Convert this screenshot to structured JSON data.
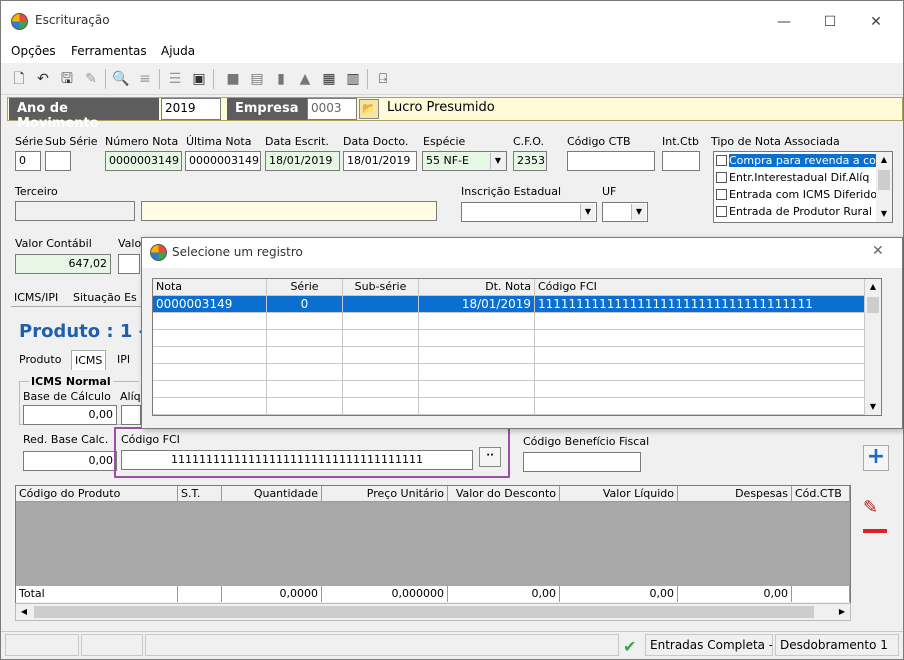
{
  "window": {
    "title": "Escrituração",
    "min": "—",
    "max": "☐",
    "close": "✕"
  },
  "menu": [
    "Opções",
    "Ferramentas",
    "Ajuda"
  ],
  "header": {
    "ano_label": "Ano de Movimento",
    "ano_value": "2019",
    "empresa_label": "Empresa",
    "empresa_code": "0003",
    "empresa_name": "Lucro Presumido"
  },
  "form": {
    "serie_label": "Série",
    "serie_value": "0",
    "subserie_label": "Sub Série",
    "subserie_value": "",
    "numero_label": "Número Nota",
    "numero_value": "0000003149",
    "ultima_label": "Última Nota",
    "ultima_value": "0000003149",
    "dataescrit_label": "Data Escrit.",
    "dataescrit_value": "18/01/2019",
    "datadocto_label": "Data Docto.",
    "datadocto_value": "18/01/2019",
    "especie_label": "Espécie",
    "especie_value": "55   NF-E",
    "cfo_label": "C.F.O.",
    "cfo_value": "2353",
    "ctb_label": "Código CTB",
    "ctb_value": "",
    "intctb_label": "Int.Ctb",
    "intctb_value": "",
    "tiponota_label": "Tipo de Nota Associada",
    "tiponota_items": [
      "Compra para revenda a co",
      "Entr.Interestadual Dif.Alíq",
      "Entrada com ICMS Diferido",
      "Entrada de Produtor Rural"
    ],
    "terceiro_label": "Terceiro",
    "ie_label": "Inscrição Estadual",
    "uf_label": "UF",
    "valorcontabil_label": "Valor Contábil",
    "valorcontabil_value": "647,02",
    "valo_label": "Valo"
  },
  "tabs": [
    "ICMS/IPI",
    "Situação Es"
  ],
  "produto_title": "Produto : 1 -",
  "subtabs": [
    "Produto",
    "ICMS",
    "IPI"
  ],
  "icms": {
    "group_label": "ICMS Normal",
    "base_label": "Base de Cálculo",
    "base_value": "0,00",
    "aliq_label": "Alíq",
    "red_label": "Red. Base Calc.",
    "red_value": "0,00",
    "fci_label": "Código FCI",
    "fci_value": "111111111111111111111111111111111111",
    "beneficio_label": "Código Benefício Fiscal",
    "beneficio_value": "",
    "fci_button": "··"
  },
  "dialog": {
    "title": "Selecione um registro",
    "columns": [
      "Nota",
      "Série",
      "Sub-série",
      "Dt. Nota",
      "Código FCI"
    ],
    "rows": [
      [
        "0000003149",
        "0",
        "",
        "18/01/2019",
        "111111111111111111111111111111111111"
      ]
    ]
  },
  "product_table": {
    "columns": [
      "Código do Produto",
      "S.T.",
      "Quantidade",
      "Preço Unitário",
      "Valor do Desconto",
      "Valor Líquido",
      "Despesas",
      "Cód.CTB"
    ],
    "totals": [
      "Total",
      "",
      "0,0000",
      "0,000000",
      "0,00",
      "0,00",
      "0,00",
      ""
    ]
  },
  "status": {
    "entradas": "Entradas Completa - P",
    "desdobramento": "Desdobramento 1"
  },
  "colors": {
    "accent": "#0a6fd0",
    "highlight_box": "#9b4fa8",
    "produto_title": "#1f5fb0",
    "add": "#1f66d1",
    "remove": "#e02020"
  }
}
